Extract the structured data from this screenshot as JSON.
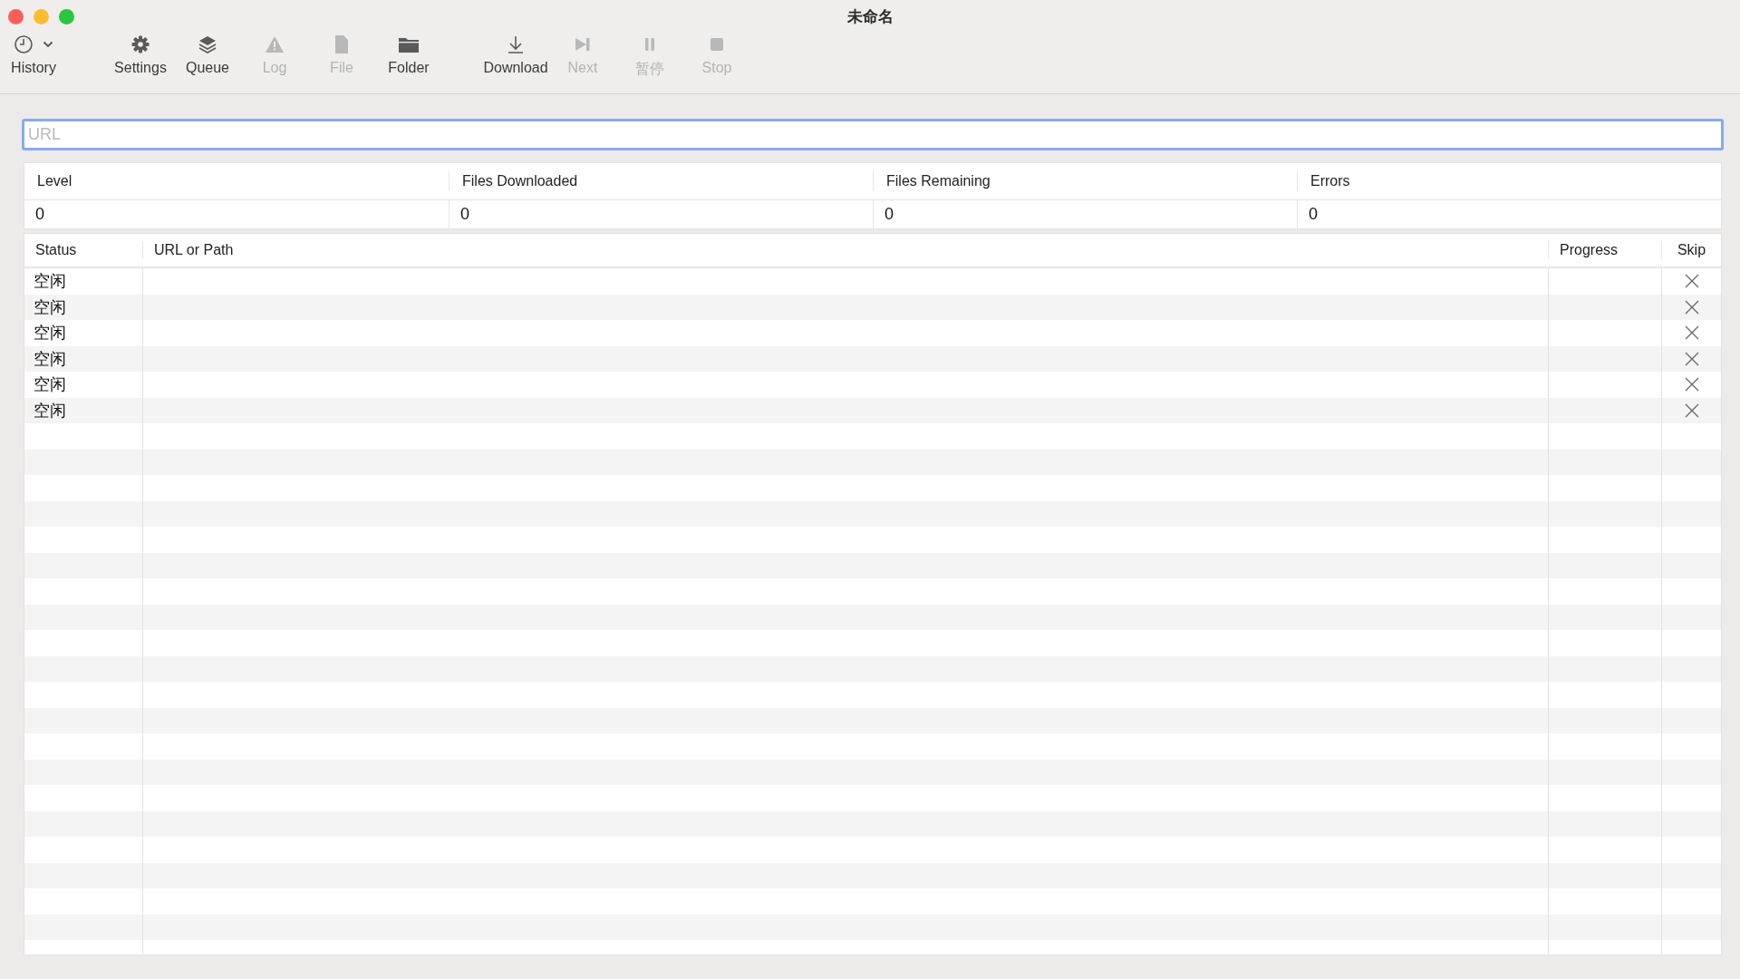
{
  "window": {
    "title": "未命名"
  },
  "toolbar": [
    {
      "items": [
        {
          "label": "History",
          "disabled": false
        }
      ]
    },
    {
      "items": [
        {
          "label": "Settings",
          "disabled": false
        },
        {
          "label": "Queue",
          "disabled": false
        },
        {
          "label": "Log",
          "disabled": true
        },
        {
          "label": "File",
          "disabled": true
        },
        {
          "label": "Folder",
          "disabled": false
        }
      ]
    },
    {
      "items": [
        {
          "label": "Download",
          "disabled": false
        },
        {
          "label": "Next",
          "disabled": true
        },
        {
          "label": "暂停",
          "disabled": true
        },
        {
          "label": "Stop",
          "disabled": true
        }
      ]
    }
  ],
  "url_field": {
    "placeholder": "URL"
  },
  "stats": {
    "columns": [
      "Level",
      "Files Downloaded",
      "Files Remaining",
      "Errors"
    ],
    "values": [
      "0",
      "0",
      "0",
      "0"
    ]
  },
  "queue": {
    "columns": [
      "Status",
      "URL or Path",
      "Progress",
      "Skip"
    ],
    "rows": [
      {
        "status": "空闲"
      },
      {
        "status": "空闲"
      },
      {
        "status": "空闲"
      },
      {
        "status": "空闲"
      },
      {
        "status": "空闲"
      },
      {
        "status": "空闲"
      }
    ]
  }
}
